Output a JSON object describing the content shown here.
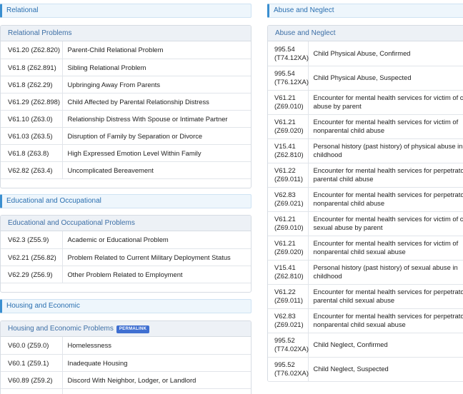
{
  "left": {
    "relational": {
      "section": "Relational",
      "header": "Relational Problems",
      "rows": [
        {
          "code": "V61.20 (Z62.820)",
          "desc": "Parent-Child Relational Problem"
        },
        {
          "code": "V61.8 (Z62.891)",
          "desc": "Sibling Relational Problem"
        },
        {
          "code": "V61.8 (Z62.29)",
          "desc": "Upbringing Away From Parents"
        },
        {
          "code": "V61.29 (Z62.898)",
          "desc": "Child Affected by Parental Relationship Distress"
        },
        {
          "code": "V61.10 (Z63.0)",
          "desc": "Relationship Distress With Spouse or Intimate Partner"
        },
        {
          "code": "V61.03 (Z63.5)",
          "desc": "Disruption of Family by Separation or Divorce"
        },
        {
          "code": "V61.8 (Z63.8)",
          "desc": "High Expressed Emotion Level Within Family"
        },
        {
          "code": "V62.82 (Z63.4)",
          "desc": "Uncomplicated Bereavement"
        }
      ]
    },
    "educational": {
      "section": "Educational and Occupational",
      "header": "Educational and Occupational Problems",
      "rows": [
        {
          "code": "V62.3 (Z55.9)",
          "desc": "Academic or Educational Problem"
        },
        {
          "code": "V62.21 (Z56.82)",
          "desc": "Problem Related to Current Military Deployment Status"
        },
        {
          "code": "V62.29 (Z56.9)",
          "desc": "Other Problem Related to Employment"
        }
      ]
    },
    "housing": {
      "section": "Housing and Economic",
      "header": "Housing and Economic Problems",
      "badge": "PERMALINK",
      "rows": [
        {
          "code": "V60.0 (Z59.0)",
          "desc": "Homelessness"
        },
        {
          "code": "V60.1 (Z59.1)",
          "desc": "Inadequate Housing"
        },
        {
          "code": "V60.89 (Z59.2)",
          "desc": "Discord With Neighbor, Lodger, or Landlord"
        }
      ]
    }
  },
  "right": {
    "section": "Abuse and Neglect",
    "header": "Abuse and Neglect",
    "rows": [
      {
        "code": "995.54 (T74.12XA)",
        "desc": "Child Physical Abuse, Confirmed"
      },
      {
        "code": "995.54 (T76.12XA)",
        "desc": "Child Physical Abuse, Suspected"
      },
      {
        "code": "V61.21 (Z69.010)",
        "desc": "Encounter for mental health services for victim of child abuse by parent"
      },
      {
        "code": "V61.21 (Z69.020)",
        "desc": "Encounter for mental health services for victim of nonparental child abuse"
      },
      {
        "code": "V15.41 (Z62.810)",
        "desc": "Personal history (past history) of physical abuse in childhood"
      },
      {
        "code": "V61.22 (Z69.011)",
        "desc": "Encounter for mental health services for perpetrator of parental child abuse"
      },
      {
        "code": "V62.83 (Z69.021)",
        "desc": "Encounter for mental health services for perpetrator of nonparental child abuse"
      },
      {
        "code": "V61.21 (Z69.010)",
        "desc": "Encounter for mental health services for victim of child sexual abuse by parent"
      },
      {
        "code": "V61.21 (Z69.020)",
        "desc": "Encounter for mental health services for victim of nonparental child sexual abuse"
      },
      {
        "code": "V15.41 (Z62.810)",
        "desc": "Personal history (past history) of sexual abuse in childhood"
      },
      {
        "code": "V61.22 (Z69.011)",
        "desc": "Encounter for mental health services for perpetrator of parental child sexual abuse"
      },
      {
        "code": "V62.83 (Z69.021)",
        "desc": "Encounter for mental health services for perpetrator of nonparental child sexual abuse"
      },
      {
        "code": "995.52 (T74.02XA)",
        "desc": "Child Neglect, Confirmed"
      },
      {
        "code": "995.52 (T76.02XA)",
        "desc": "Child Neglect, Suspected"
      }
    ]
  }
}
